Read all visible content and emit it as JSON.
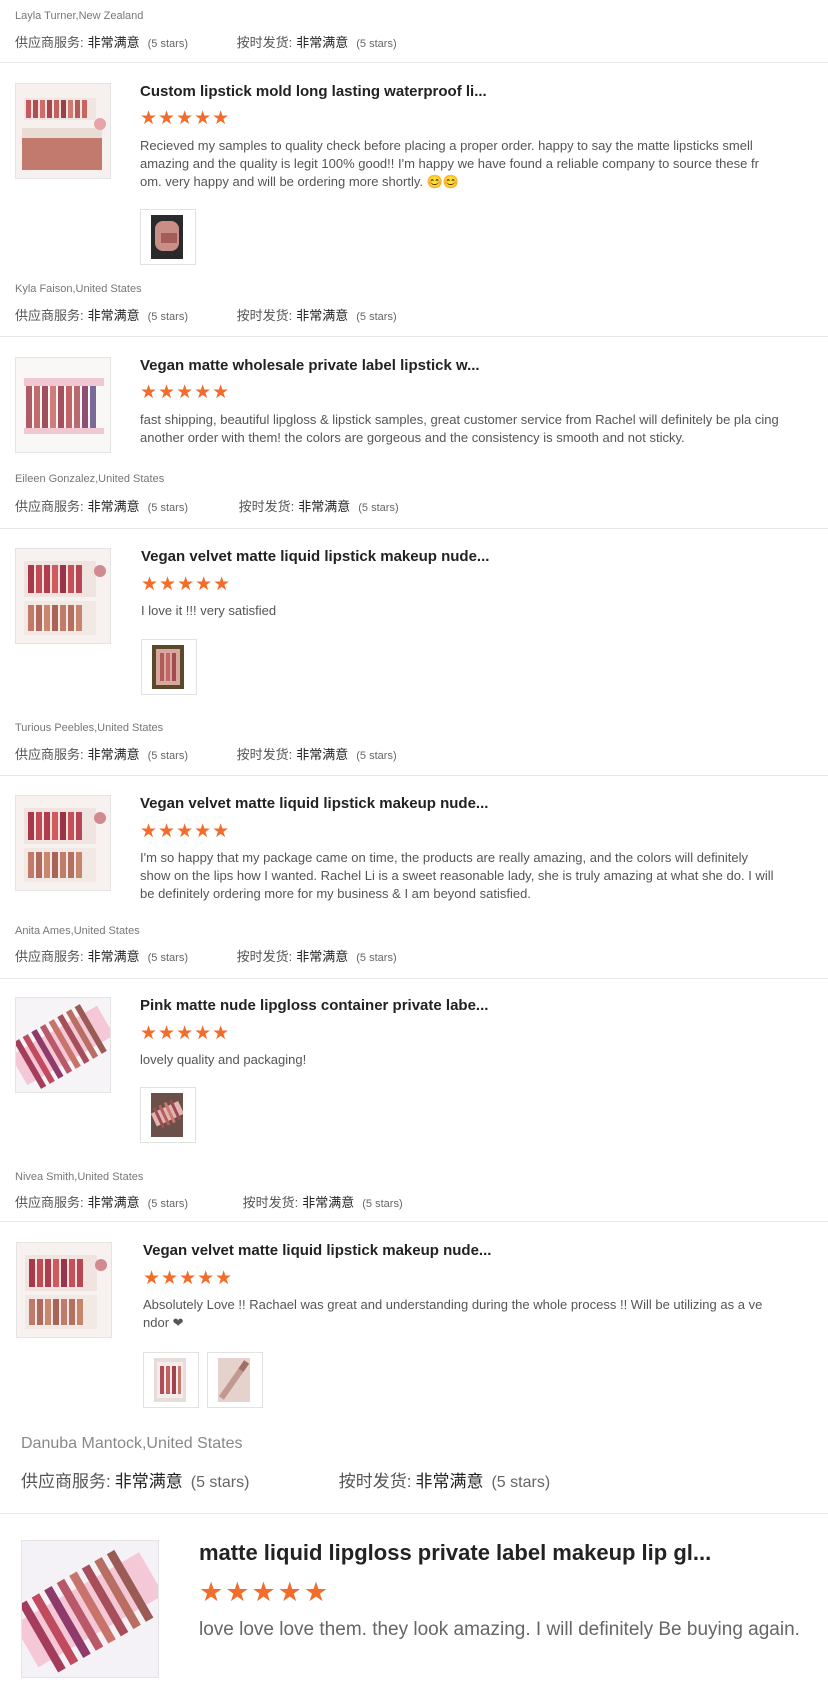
{
  "colors": {
    "star": "#f26c2b",
    "divider": "#e6e6e6"
  },
  "top": {
    "reviewer": "Layla Turner,New Zealand",
    "supplier_label": "供应商服务:",
    "supplier_value": "非常满意",
    "supplier_count": "(5 stars)",
    "ship_label": "按时发货:",
    "ship_value": "非常满意",
    "ship_count": "(5 stars)"
  },
  "reviews": [
    {
      "title": "Custom lipstick mold long lasting waterproof li...",
      "stars": "★★★★★",
      "rating": 5,
      "comment": "Recieved my samples to quality check before placing a proper order. happy to say the matte lipsticks smell amazing and the quality is legit 100% good!! I'm happy we have found a reliable company to source these fr om. very happy and will be ordering more shortly. 😊😊",
      "reviewer": "Kyla Faison,United States",
      "supplier_label": "供应商服务:",
      "supplier_value": "非常满意",
      "supplier_count": "(5 stars)",
      "ship_label": "按时发货:",
      "ship_value": "非常满意",
      "ship_count": "(5 stars)"
    },
    {
      "title": "Vegan matte wholesale private label lipstick w...",
      "stars": "★★★★★",
      "rating": 5,
      "comment": "fast shipping, beautiful lipgloss & lipstick samples, great customer service from Rachel will definitely be pla cing another order with them! the colors are gorgeous and the consistency is smooth and not sticky.",
      "reviewer": "Eileen Gonzalez,United States",
      "supplier_label": "供应商服务:",
      "supplier_value": "非常满意",
      "supplier_count": "(5 stars)",
      "ship_label": "按时发货:",
      "ship_value": "非常满意",
      "ship_count": "(5 stars)"
    },
    {
      "title": "Vegan velvet matte liquid lipstick makeup nude...",
      "stars": "★★★★★",
      "rating": 5,
      "comment": "I love it !!!  very satisfied",
      "reviewer": "Turious Peebles,United States",
      "supplier_label": "供应商服务:",
      "supplier_value": "非常满意",
      "supplier_count": "(5 stars)",
      "ship_label": "按时发货:",
      "ship_value": "非常满意",
      "ship_count": "(5 stars)"
    },
    {
      "title": "Vegan velvet matte liquid lipstick makeup nude...",
      "stars": "★★★★★",
      "rating": 5,
      "comment": "I'm so happy that my package came on time, the products are really amazing, and the colors will definitely show on the lips how I wanted. Rachel Li is a sweet reasonable lady, she is truly amazing at what she do. I will be definitely ordering more for my business & I am beyond satisfied.",
      "reviewer": "Anita Ames,United States",
      "supplier_label": "供应商服务:",
      "supplier_value": "非常满意",
      "supplier_count": "(5 stars)",
      "ship_label": "按时发货:",
      "ship_value": "非常满意",
      "ship_count": "(5 stars)"
    },
    {
      "title": "Pink matte nude lipgloss container private labe...",
      "stars": "★★★★★",
      "rating": 5,
      "comment": "lovely quality and packaging!",
      "reviewer": "Nivea Smith,United States",
      "supplier_label": "供应商服务:",
      "supplier_value": "非常满意",
      "supplier_count": "(5 stars)",
      "ship_label": "按时发货:",
      "ship_value": "非常满意",
      "ship_count": "(5 stars)"
    },
    {
      "title": "Vegan velvet matte liquid lipstick makeup nude...",
      "stars": "★★★★★",
      "rating": 5,
      "comment": "Absolutely Love !! Rachael was great and understanding during the whole process !! Will be utilizing as a ve ndor ❤",
      "reviewer": "Danuba Mantock,United States",
      "supplier_label": "供应商服务:",
      "supplier_value": "非常满意",
      "supplier_count": "(5 stars)",
      "ship_label": "按时发货:",
      "ship_value": "非常满意",
      "ship_count": "(5 stars)"
    },
    {
      "title": "matte liquid lipgloss private label makeup lip gl...",
      "stars": "★★★★★",
      "rating": 5,
      "comment": "love love love them. they look amazing. I will definitely Be buying again."
    }
  ]
}
